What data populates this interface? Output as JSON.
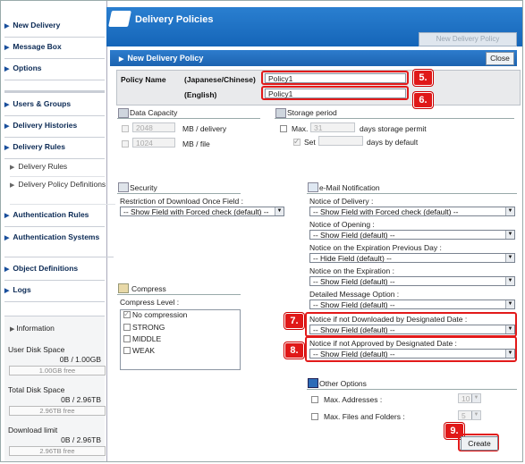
{
  "sidebar": {
    "items": [
      {
        "label": "New Delivery"
      },
      {
        "label": "Message Box"
      },
      {
        "label": "Options"
      },
      {
        "label": "Users & Groups"
      },
      {
        "label": "Delivery Histories"
      },
      {
        "label": "Delivery Rules"
      },
      {
        "label": "Delivery Rules"
      },
      {
        "label": "Delivery Policy Definitions"
      },
      {
        "label": "Authentication Rules"
      },
      {
        "label": "Authentication Systems"
      },
      {
        "label": "Object Definitions"
      },
      {
        "label": "Logs"
      }
    ],
    "info": {
      "title": "Information",
      "user_disk_label": "User Disk Space",
      "user_disk_value": "0B / 1.00GB",
      "user_disk_free": "1.00GB free",
      "total_disk_label": "Total Disk Space",
      "total_disk_value": "0B / 2.96TB",
      "total_disk_free": "2.96TB free",
      "download_label": "Download limit",
      "download_value": "0B / 2.96TB",
      "download_free": "2.96TB free"
    }
  },
  "header": {
    "title": "Delivery Policies",
    "new_policy_button": "New Delivery Policy"
  },
  "panel": {
    "title": "New Delivery Policy",
    "close_label": "Close",
    "policy_name_label": "Policy Name",
    "japanese_label": "(Japanese/Chinese)",
    "english_label": "(English)",
    "japanese_value": "Policy1",
    "english_value": "Policy1"
  },
  "capacity": {
    "title": "Data Capacity",
    "per_delivery_value": "2048",
    "per_delivery_unit": "MB / delivery",
    "per_file_value": "1024",
    "per_file_unit": "MB / file"
  },
  "storage": {
    "title": "Storage period",
    "max_label": "Max.",
    "max_value": "31",
    "max_unit": "days storage permit",
    "set_label": "Set",
    "set_unit": "days by default"
  },
  "security": {
    "title": "Security",
    "restriction_label": "Restriction of Download Once Field :",
    "restriction_value": "-- Show Field with Forced check (default) --"
  },
  "compress": {
    "title": "Compress",
    "level_label": "Compress Level :",
    "options": [
      "No compression",
      "STRONG",
      "MIDDLE",
      "WEAK"
    ]
  },
  "email": {
    "title": "e-Mail Notification",
    "delivery_label": "Notice of Delivery :",
    "delivery_value": "-- Show Field with Forced check (default) --",
    "opening_label": "Notice of Opening :",
    "opening_value": "-- Show Field (default) --",
    "expiration_prev_label": "Notice on the Expiration Previous Day :",
    "expiration_prev_value": "-- Hide Field (default) --",
    "expiration_label": "Notice on the Expiration :",
    "expiration_value": "-- Show Field (default) --",
    "detailed_label": "Detailed Message Option :",
    "detailed_value": "-- Show Field (default) --",
    "not_downloaded_label": "Notice if not Downloaded by Designated Date :",
    "not_downloaded_value": "-- Show Field (default) --",
    "not_approved_label": "Notice if not Approved by Designated Date :",
    "not_approved_value": "-- Show Field (default) --"
  },
  "other": {
    "title": "Other Options",
    "max_addresses_label": "Max. Addresses :",
    "max_addresses_value": "10",
    "max_files_label": "Max. Files and Folders :",
    "max_files_value": "5"
  },
  "create_label": "Create",
  "badges": [
    "5.",
    "6.",
    "7.",
    "8.",
    "9."
  ]
}
